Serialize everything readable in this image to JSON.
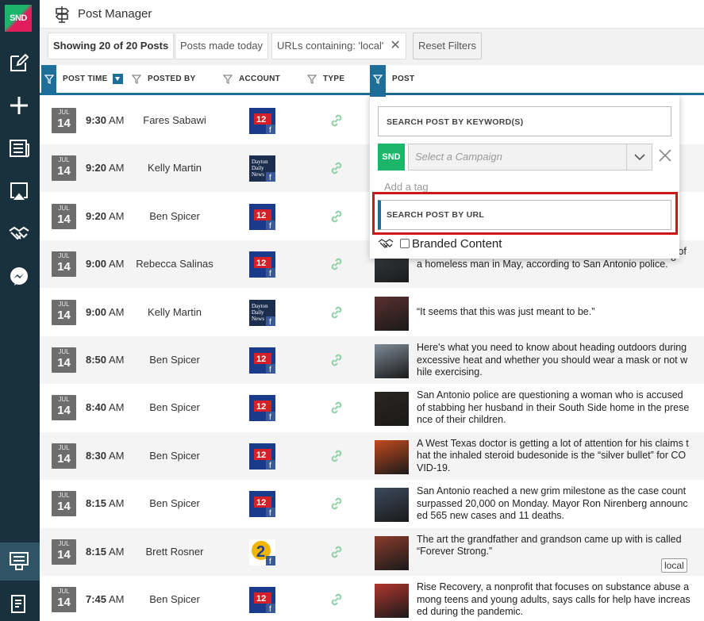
{
  "app": {
    "title": "Post Manager",
    "logo": "SND"
  },
  "sidebar": {
    "items": [
      {
        "icon": "edit-icon"
      },
      {
        "icon": "plus-icon"
      },
      {
        "icon": "newspaper-icon"
      },
      {
        "icon": "airplay-icon"
      },
      {
        "icon": "handshake-icon"
      },
      {
        "icon": "messenger-icon"
      },
      {
        "icon": "post-manager-icon"
      },
      {
        "icon": "report-icon"
      }
    ]
  },
  "filters": {
    "showing_prefix": "Showing 20 of 20 Posts",
    "today": "Posts made today",
    "urls": "URLs containing: 'local'",
    "reset": "Reset Filters"
  },
  "columns": {
    "post_time": "POST TIME",
    "posted_by": "POSTED BY",
    "account": "ACCOUNT",
    "type": "TYPE",
    "post": "POST"
  },
  "popover": {
    "keyword_placeholder": "SEARCH POST BY KEYWORD(S)",
    "campaign_logo": "SND",
    "campaign_placeholder": "Select a Campaign",
    "add_tag": "Add a tag",
    "url_placeholder": "SEARCH POST BY URL",
    "branded": "Branded Content"
  },
  "row_cut": [
    "nl",
    "e",
    "o"
  ],
  "accent": "#1e6e9a",
  "highlight": "#d0161a",
  "rows": [
    {
      "mon": "JUL",
      "day": "14",
      "time": "9:30",
      "ampm": "AM",
      "by": "Fares Sabawi",
      "acct": "ksat",
      "text": ""
    },
    {
      "mon": "JUL",
      "day": "14",
      "time": "9:20",
      "ampm": "AM",
      "by": "Kelly Martin",
      "acct": "dayton",
      "text": ""
    },
    {
      "mon": "JUL",
      "day": "14",
      "time": "9:20",
      "ampm": "AM",
      "by": "Ben Spicer",
      "acct": "ksat",
      "text": ""
    },
    {
      "mon": "JUL",
      "day": "14",
      "time": "9:00",
      "ampm": "AM",
      "by": "Rebecca Salinas",
      "acct": "ksat",
      "text": "An 18-year-old man has been arrested in the fatal stabbing of a homeless man in May, according to San Antonio police."
    },
    {
      "mon": "JUL",
      "day": "14",
      "time": "9:00",
      "ampm": "AM",
      "by": "Kelly Martin",
      "acct": "dayton",
      "text": "“It seems that this was just meant to be.”"
    },
    {
      "mon": "JUL",
      "day": "14",
      "time": "8:50",
      "ampm": "AM",
      "by": "Ben Spicer",
      "acct": "ksat",
      "text": "Here's what you need to know about heading outdoors during excessive heat and whether you should wear a mask or not while exercising."
    },
    {
      "mon": "JUL",
      "day": "14",
      "time": "8:40",
      "ampm": "AM",
      "by": "Ben Spicer",
      "acct": "ksat",
      "text": "San Antonio police are questioning a woman who is accused of stabbing her husband in their South Side home in the presence of their children."
    },
    {
      "mon": "JUL",
      "day": "14",
      "time": "8:30",
      "ampm": "AM",
      "by": "Ben Spicer",
      "acct": "ksat",
      "text": "A West Texas doctor is getting a lot of attention for his claims that the inhaled steroid budesonide is the “silver bullet” for COVID-19."
    },
    {
      "mon": "JUL",
      "day": "14",
      "time": "8:15",
      "ampm": "AM",
      "by": "Ben Spicer",
      "acct": "ksat",
      "text": "San Antonio reached a new grim milestone as the case count surpassed 20,000 on Monday. Mayor Ron Nirenberg announced 565 new cases and 11 deaths."
    },
    {
      "mon": "JUL",
      "day": "14",
      "time": "8:15",
      "ampm": "AM",
      "by": "Brett Rosner",
      "acct": "wsb",
      "text": "The art the grandfather and grandson came up with is called “Forever Strong.”",
      "tag": "local"
    },
    {
      "mon": "JUL",
      "day": "14",
      "time": "7:45",
      "ampm": "AM",
      "by": "Ben Spicer",
      "acct": "ksat",
      "text": "Rise Recovery, a nonprofit that focuses on substance abuse among teens and young adults, says calls for help have increased during the pandemic."
    }
  ]
}
